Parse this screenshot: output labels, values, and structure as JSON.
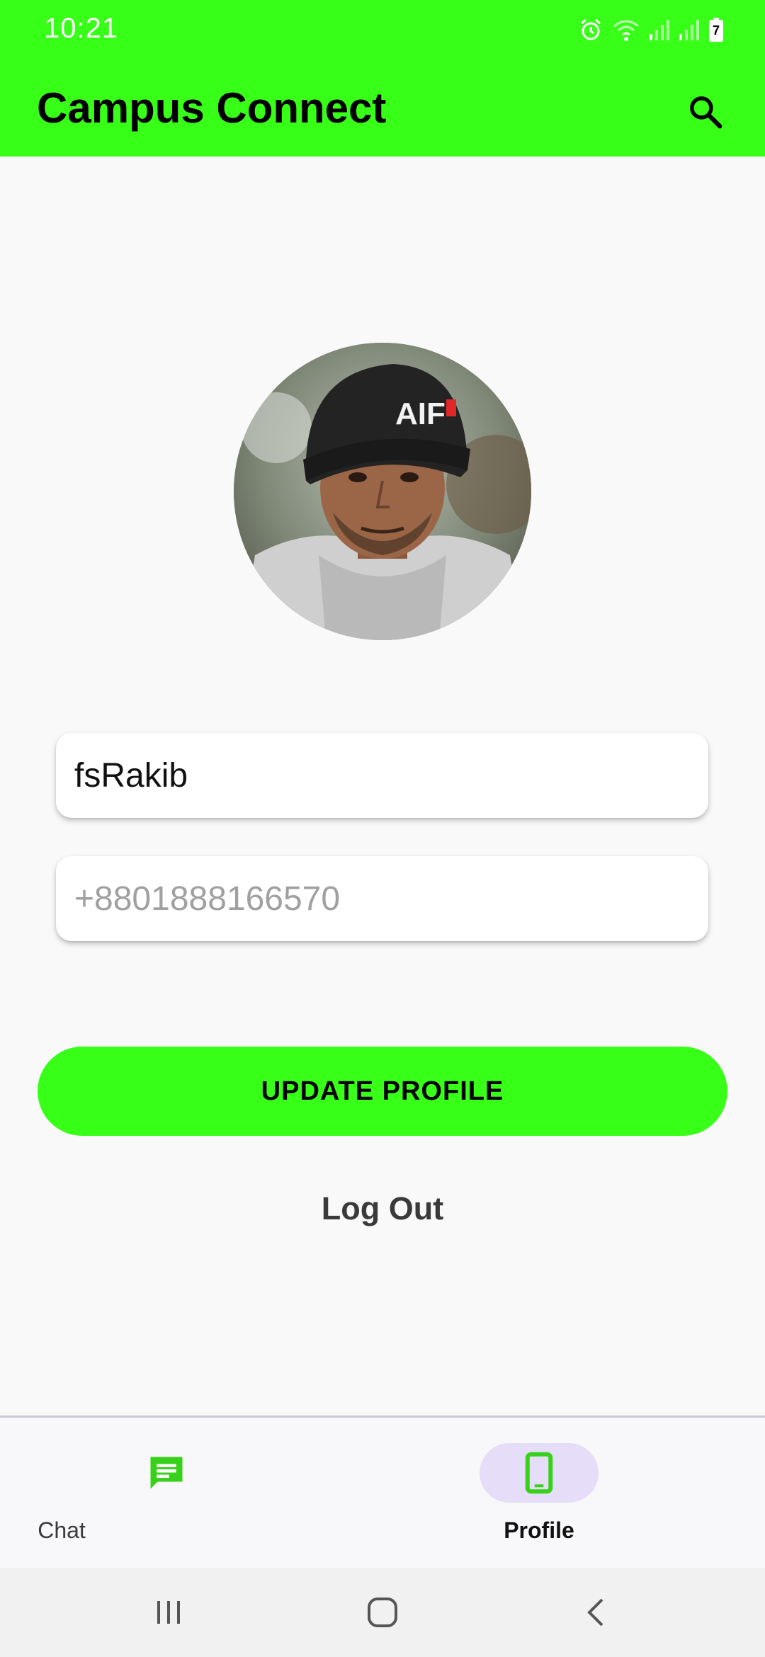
{
  "status_bar": {
    "time": "10:21",
    "battery_level": "7"
  },
  "app_bar": {
    "title": "Campus Connect",
    "search_icon": "search-icon"
  },
  "profile": {
    "avatar_icon": "avatar-photo",
    "username_value": "fsRakib",
    "phone_placeholder": "+8801888166570",
    "update_button_label": "UPDATE PROFILE",
    "logout_label": "Log Out"
  },
  "bottom_nav": {
    "items": [
      {
        "label": "Chat",
        "icon": "chat-icon",
        "active": false
      },
      {
        "label": "Profile",
        "icon": "phone-icon",
        "active": true
      }
    ]
  },
  "colors": {
    "accent": "#37ff17",
    "active_pill": "#e6ddf8",
    "background": "#f9f9f9"
  }
}
